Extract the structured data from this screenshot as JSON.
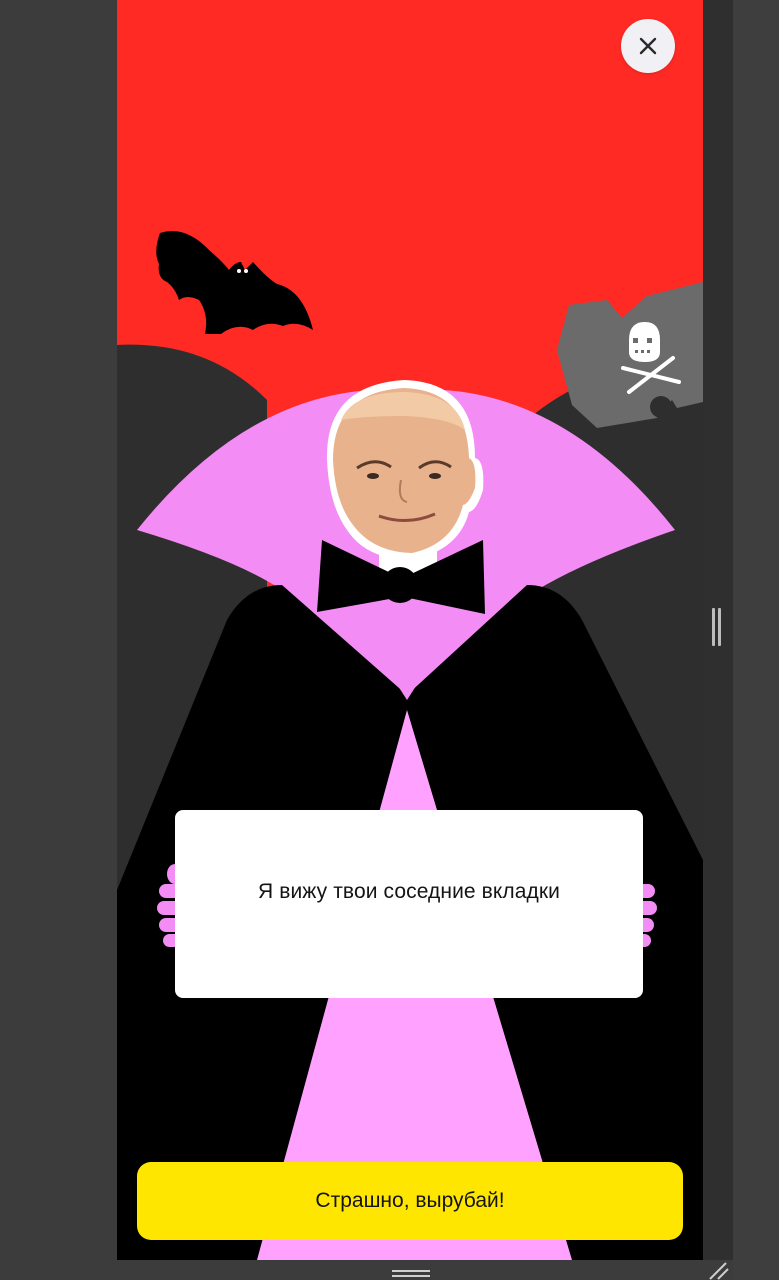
{
  "dialog": {
    "message": "Я вижу твои соседние вкладки",
    "cta_label": "Страшно, вырубай!"
  },
  "icons": {
    "close": "close-icon",
    "bat": "bat-icon",
    "skull": "skull-and-crossbones-icon"
  },
  "colors": {
    "background": "#ff2a24",
    "cape_lining": "#f48cf5",
    "cape": "#000000",
    "cta": "#ffe600",
    "dark_hills": "#2e2e2e"
  }
}
